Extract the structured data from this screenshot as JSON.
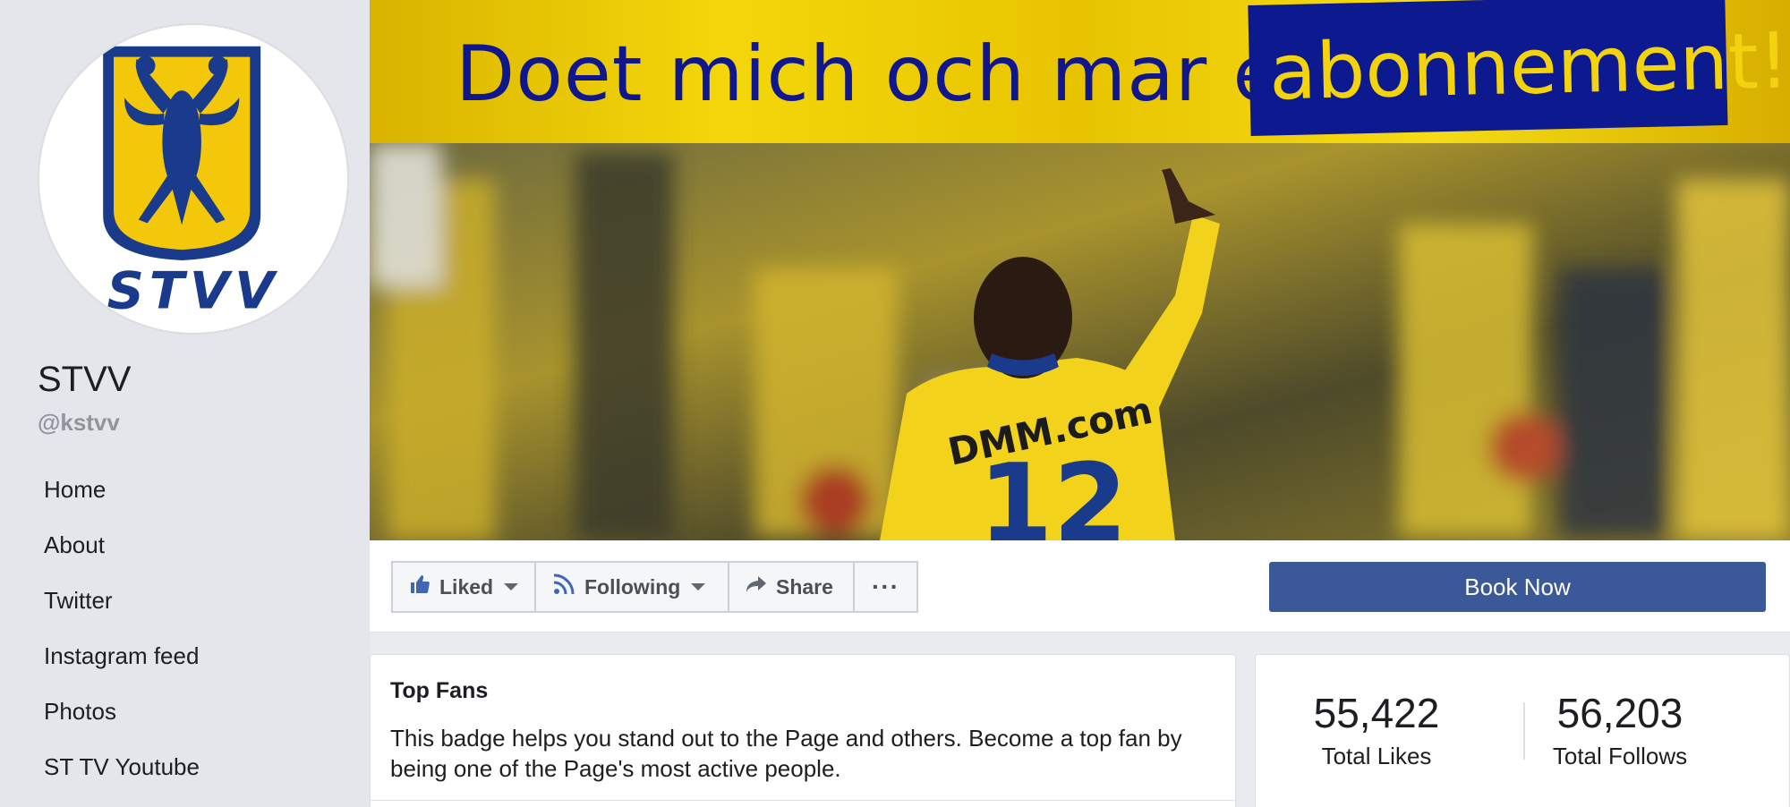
{
  "page": {
    "name": "STVV",
    "handle": "@kstvv"
  },
  "logo": {
    "lettering": "STVV",
    "colors": {
      "gold": "#f3c80a",
      "navy": "#1a3a8c"
    }
  },
  "sidebar": {
    "items": [
      {
        "label": "Home"
      },
      {
        "label": "About"
      },
      {
        "label": "Twitter"
      },
      {
        "label": "Instagram feed"
      },
      {
        "label": "Photos"
      },
      {
        "label": "ST TV Youtube"
      }
    ]
  },
  "cover": {
    "banner_text": "Doet mich och mar en",
    "banner_highlight": "abonnement!",
    "jersey_sponsor": "DMM.com",
    "jersey_number": "12",
    "colors": {
      "banner_yellow": "#f3d70a",
      "banner_navy": "#0d1a8f"
    }
  },
  "actions": {
    "liked": "Liked",
    "following": "Following",
    "share": "Share",
    "more": "···",
    "book_now": "Book Now",
    "colors": {
      "primary": "#3b5998"
    }
  },
  "top_fans": {
    "title": "Top Fans",
    "description": "This badge helps you stand out to the Page and others. Become a top fan by being one of the Page's most active people."
  },
  "stats": {
    "likes_value": "55,422",
    "likes_label": "Total Likes",
    "follows_value": "56,203",
    "follows_label": "Total Follows"
  }
}
